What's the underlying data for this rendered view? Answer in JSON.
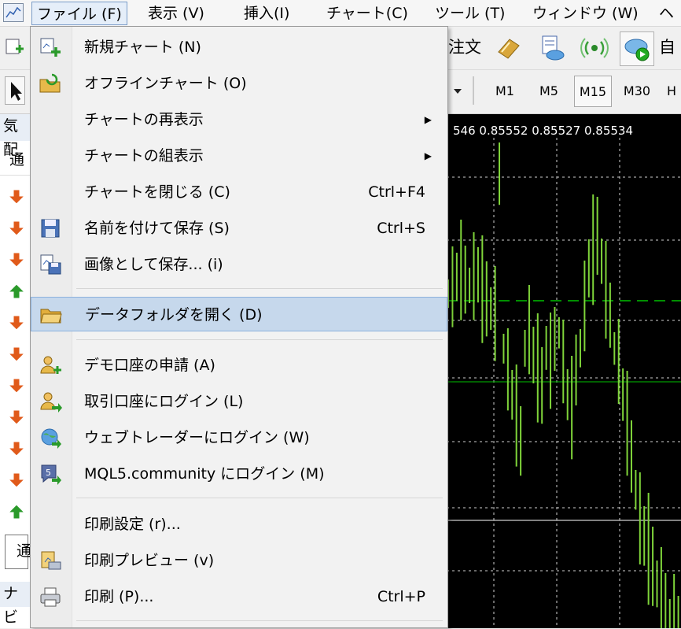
{
  "menubar": {
    "items": [
      {
        "label": "ファイル (F)"
      },
      {
        "label": "表示 (V)"
      },
      {
        "label": "挿入(I)"
      },
      {
        "label": "チャート(C)"
      },
      {
        "label": "ツール (T)"
      },
      {
        "label": "ウィンドウ (W)"
      },
      {
        "label": "ヘ"
      }
    ]
  },
  "toolbar": {
    "order_label": "注文",
    "auto_label": "自",
    "timeframes": [
      "M1",
      "M5",
      "M15",
      "M30",
      "H"
    ],
    "selected_timeframe": "M15"
  },
  "left_panel": {
    "header": "気配",
    "tab": "通",
    "bottom_tab": "通",
    "navigator": "ナビ",
    "arrows": [
      "down",
      "down",
      "down",
      "up",
      "down",
      "down",
      "down",
      "down",
      "down",
      "down",
      "up"
    ]
  },
  "chart": {
    "price_line": "546 0.85552 0.85527 0.85534",
    "colors": {
      "background": "#000000",
      "candle": "#7fd43a",
      "grid": "#d0d0d0",
      "level": "#00c000"
    }
  },
  "file_menu": {
    "items": [
      {
        "label": "新規チャート (N)",
        "icon": "new-chart-icon",
        "shortcut": "",
        "submenu": false
      },
      {
        "label": "オフラインチャート (O)",
        "icon": "offline-chart-folder-icon",
        "shortcut": "",
        "submenu": false
      },
      {
        "label": "チャートの再表示",
        "icon": "",
        "shortcut": "",
        "submenu": true
      },
      {
        "label": "チャートの組表示",
        "icon": "",
        "shortcut": "",
        "submenu": true
      },
      {
        "label": "チャートを閉じる (C)",
        "icon": "",
        "shortcut": "Ctrl+F4",
        "submenu": false
      },
      {
        "label": "名前を付けて保存 (S)",
        "icon": "save-icon",
        "shortcut": "Ctrl+S",
        "submenu": false
      },
      {
        "label": "画像として保存... (i)",
        "icon": "save-picture-icon",
        "shortcut": "",
        "submenu": false
      },
      {
        "label": "データフォルダを開く (D)",
        "icon": "open-folder-icon",
        "shortcut": "",
        "submenu": false,
        "highlighted": true
      },
      {
        "label": "デモ口座の申請 (A)",
        "icon": "demo-account-icon",
        "shortcut": "",
        "submenu": false
      },
      {
        "label": "取引口座にログイン (L)",
        "icon": "login-account-icon",
        "shortcut": "",
        "submenu": false
      },
      {
        "label": "ウェブトレーダーにログイン (W)",
        "icon": "web-trader-icon",
        "shortcut": "",
        "submenu": false
      },
      {
        "label": "MQL5.community にログイン (M)",
        "icon": "mql5-login-icon",
        "shortcut": "",
        "submenu": false
      },
      {
        "label": "印刷設定 (r)...",
        "icon": "",
        "shortcut": "",
        "submenu": false
      },
      {
        "label": "印刷プレビュー (v)",
        "icon": "print-preview-icon",
        "shortcut": "",
        "submenu": false
      },
      {
        "label": "印刷 (P)...",
        "icon": "printer-icon",
        "shortcut": "Ctrl+P",
        "submenu": false
      }
    ]
  }
}
